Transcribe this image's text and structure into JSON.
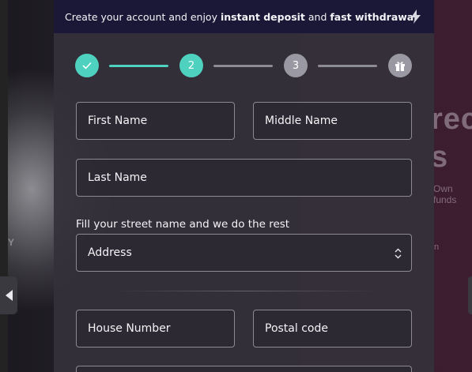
{
  "banner": {
    "prefix": "Create your account and enjoy ",
    "bold1": "instant deposit",
    "middle": " and ",
    "bold2": "fast withdrawal",
    "icon": "lightning-bolt-icon"
  },
  "steps": [
    {
      "label": "",
      "state": "completed",
      "icon": "check-icon"
    },
    {
      "label": "2",
      "state": "active"
    },
    {
      "label": "3",
      "state": "upcoming"
    },
    {
      "label": "",
      "state": "upcoming",
      "icon": "gift-icon"
    }
  ],
  "form": {
    "first_name": "First Name",
    "middle_name": "Middle Name",
    "last_name": "Last Name",
    "street_hint": "Fill your street name and we do the rest",
    "address": "Address",
    "house_number": "House Number",
    "postal_code": "Postal code"
  },
  "background": {
    "heading_fragment_1": "rec",
    "heading_fragment_2": "s",
    "small_text": "Own funds",
    "letter_y": "Y",
    "letter_n": "n"
  },
  "colors": {
    "accent": "#4fd1c0",
    "banner": "#1b1837",
    "inactive_step": "#9a98a2"
  }
}
